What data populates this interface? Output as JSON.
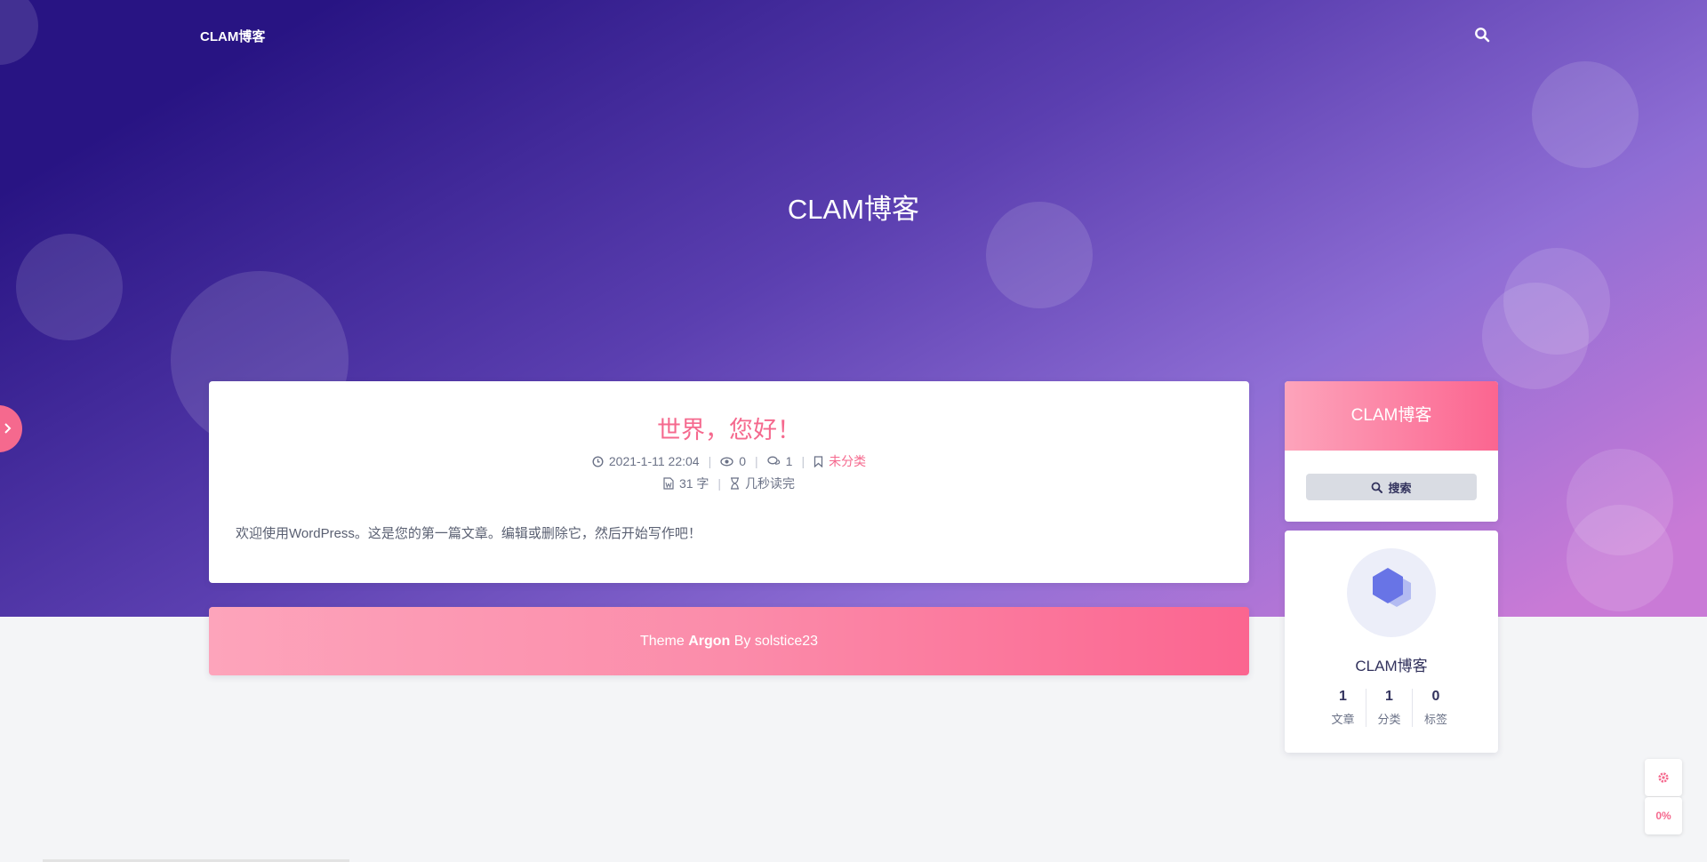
{
  "nav": {
    "brand": "CLAM博客",
    "search_icon": "search-icon"
  },
  "banner": {
    "title": "CLAM博客"
  },
  "post": {
    "title": "世界，您好！",
    "date": "2021-1-11 22:04",
    "views": "0",
    "comments": "1",
    "category": "未分类",
    "word_count": "31 字",
    "read_time": "几秒读完",
    "excerpt": "欢迎使用WordPress。这是您的第一篇文章。编辑或删除它，然后开始写作吧！"
  },
  "footer": {
    "prefix": "Theme ",
    "theme": "Argon",
    "suffix": " By solstice23"
  },
  "sidebar": {
    "header_title": "CLAM博客",
    "search_label": "搜索",
    "profile_name": "CLAM博客",
    "stats": [
      {
        "num": "1",
        "label": "文章"
      },
      {
        "num": "1",
        "label": "分类"
      },
      {
        "num": "0",
        "label": "标签"
      }
    ]
  },
  "floating": {
    "settings_icon": "gear-icon",
    "progress": "0%"
  },
  "colors": {
    "accent": "#f5698e",
    "banner_start": "#281483",
    "banner_end": "#c97ad6"
  }
}
